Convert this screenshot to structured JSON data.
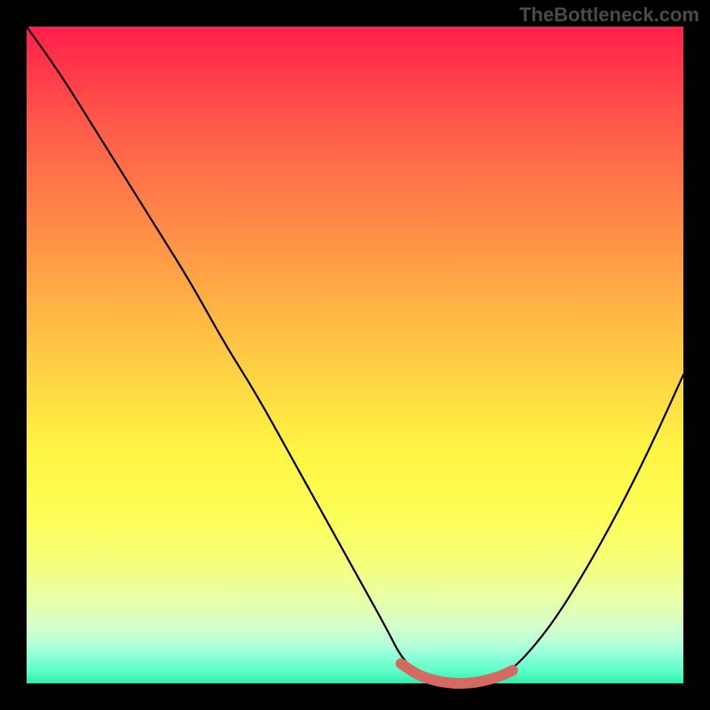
{
  "watermark": "TheBottleneck.com",
  "chart_data": {
    "type": "line",
    "title": "",
    "xlabel": "",
    "ylabel": "",
    "xlim": [
      0,
      100
    ],
    "ylim": [
      0,
      100
    ],
    "series": [
      {
        "name": "bottleneck-curve",
        "x": [
          0,
          5,
          10,
          15,
          20,
          25,
          30,
          35,
          40,
          45,
          50,
          55,
          57,
          60,
          64,
          68,
          72,
          75,
          80,
          85,
          90,
          95,
          100
        ],
        "values": [
          100,
          93,
          85,
          77,
          69,
          61,
          52,
          44,
          35,
          26,
          17,
          8,
          4,
          1,
          0,
          0,
          1,
          3,
          9,
          17,
          26,
          36,
          47
        ]
      }
    ],
    "highlight": {
      "name": "optimal-range",
      "x": [
        57,
        60,
        64,
        68,
        72,
        74
      ],
      "values": [
        3,
        1,
        0,
        0,
        1,
        2
      ]
    }
  }
}
